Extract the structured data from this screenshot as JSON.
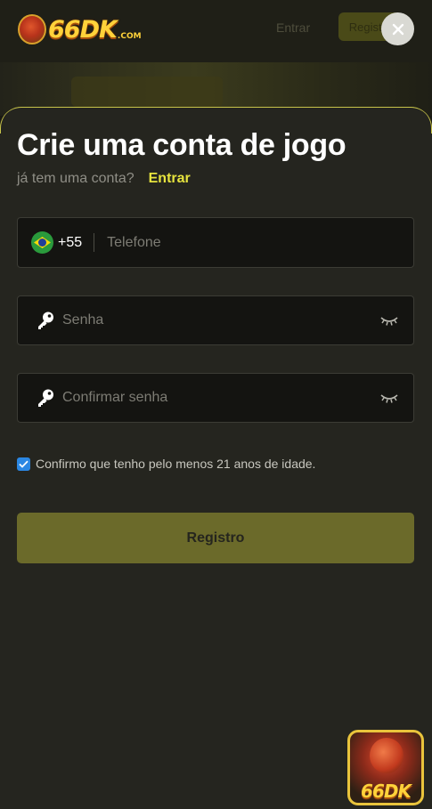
{
  "brand": {
    "logo_text": "66DK",
    "logo_suffix": ".COM"
  },
  "bg_header": {
    "nav_text": "Entrar",
    "nav_button": "Registro"
  },
  "modal": {
    "title": "Crie uma conta de jogo",
    "subtitle": "já tem uma conta?",
    "login_link": "Entrar",
    "phone": {
      "country_code": "+55",
      "placeholder": "Telefone",
      "flag": "brazil-flag"
    },
    "password": {
      "placeholder": "Senha"
    },
    "confirm_password": {
      "placeholder": "Confirmar senha"
    },
    "age_confirm": {
      "label": "Confirmo que tenho pelo menos 21 anos de idade.",
      "checked": true
    },
    "register_button": "Registro"
  },
  "promo_badge": {
    "text": "66DK"
  },
  "colors": {
    "accent": "#e6e33e",
    "sheet_bg": "#25251f",
    "button_bg": "#6b6a2a",
    "checkbox": "#2b87e3"
  }
}
